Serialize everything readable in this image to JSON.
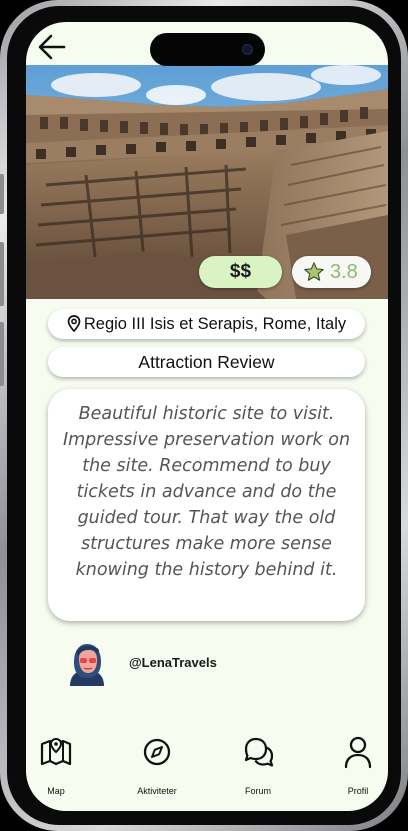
{
  "header": {
    "back_icon": "arrow-left-icon"
  },
  "attraction": {
    "price_level": "$$",
    "rating": "3.8",
    "location": "Regio III Isis et Serapis, Rome, Italy",
    "section_title": "Attraction Review",
    "review_text": "Beautiful historic site to visit. Impressive preservation work on the site.  Recommend to buy tickets in advance and do the guided tour. That way the old structures make more sense knowing the history behind it.",
    "author": "@LenaTravels"
  },
  "colors": {
    "screen_background": "#f6fcef",
    "price_pill": "#d9f3c3",
    "rating_text": "#8fb872",
    "star_fill": "#a6c96a"
  },
  "tabbar": {
    "items": [
      {
        "label": "Map",
        "icon": "folded-map-icon"
      },
      {
        "label": "Aktiviteter",
        "icon": "compass-icon"
      },
      {
        "label": "Forum",
        "icon": "chat-bubbles-icon"
      },
      {
        "label": "Profil",
        "icon": "person-icon"
      }
    ]
  }
}
